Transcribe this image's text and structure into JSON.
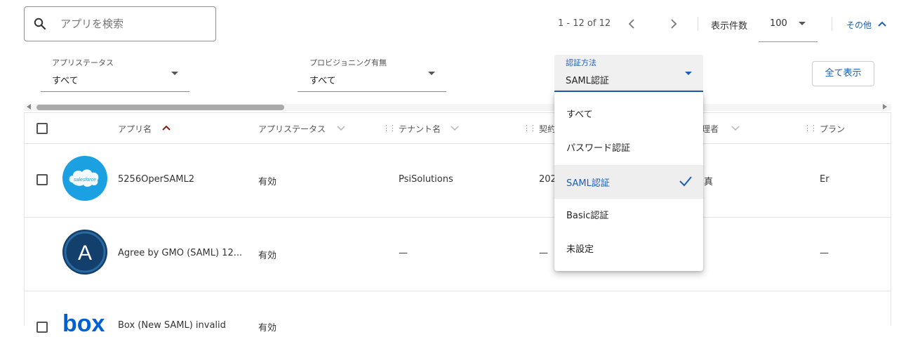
{
  "search": {
    "placeholder": "アプリを検索"
  },
  "pagination": {
    "range": "1 - 12 of 12",
    "per_page_label": "表示件数",
    "per_page_value": "100",
    "more_label": "その他"
  },
  "filters": {
    "app_status": {
      "label": "アプリステータス",
      "value": "すべて"
    },
    "provisioning": {
      "label": "プロビジョニング有無",
      "value": "すべて"
    },
    "auth_method": {
      "label": "認証方法",
      "value": "SAML認証"
    }
  },
  "show_all_label": "全て表示",
  "table": {
    "columns": {
      "app_name": "アプリ名",
      "app_status": "アプリステータス",
      "tenant": "テナント名",
      "contract": "契約",
      "admin": "理者",
      "plan": "プラン"
    },
    "rows": [
      {
        "logo": "salesforce",
        "name": "5256OperSAML2",
        "status": "有効",
        "tenant": "PsiSolutions",
        "contract": "202",
        "admin": "真",
        "plan": "Er"
      },
      {
        "logo": "A",
        "name": "Agree by GMO (SAML) 12...",
        "status": "有効",
        "tenant": "—",
        "contract": "—",
        "admin": "",
        "plan": "—"
      },
      {
        "logo": "box",
        "name": "Box (New SAML) invalid",
        "status": "有効",
        "tenant": "",
        "contract": "",
        "admin": "",
        "plan": ""
      }
    ]
  },
  "auth_menu": {
    "options": [
      "すべて",
      "パスワード認証",
      "SAML認証",
      "Basic認証",
      "未設定"
    ],
    "selected": "SAML認証"
  },
  "colors": {
    "accent": "#1a5fb4",
    "sort_arrow": "#8b1a1a",
    "salesforce": "#1ba1e2",
    "agree": "#123f6b",
    "box": "#0061d5"
  }
}
